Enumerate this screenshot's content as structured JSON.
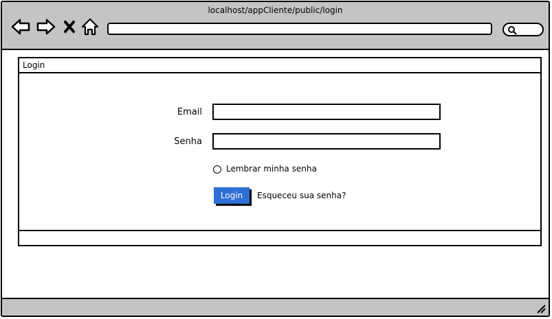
{
  "browser": {
    "url_title": "localhost/appCliente/public/login",
    "address_value": ""
  },
  "icons": {
    "back": "back-arrow-icon",
    "forward": "forward-arrow-icon",
    "stop": "close-icon",
    "home": "home-icon",
    "search": "search-icon",
    "resize": "resize-grip-icon"
  },
  "panel": {
    "title": "Login"
  },
  "form": {
    "email_label": "Email",
    "email_value": "",
    "password_label": "Senha",
    "password_value": "",
    "remember_label": "Lembrar minha senha",
    "remember_checked": false,
    "login_button": "Login",
    "forgot_link": "Esqueceu sua senha?"
  },
  "colors": {
    "chrome": "#c4c4c4",
    "primary_button": "#2f6fd6"
  }
}
